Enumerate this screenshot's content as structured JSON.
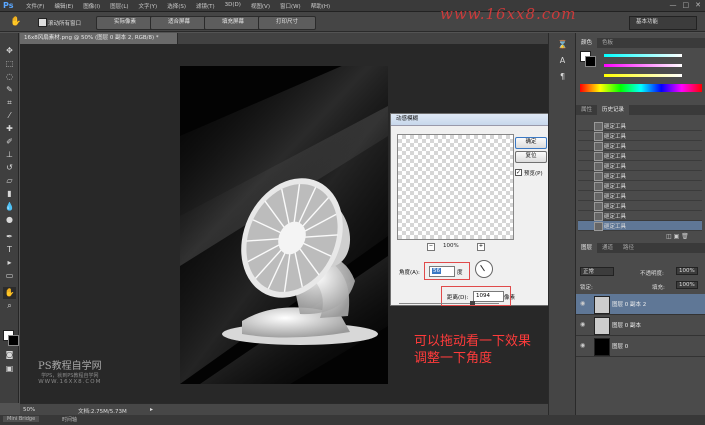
{
  "app": {
    "logo": "Ps"
  },
  "menu": [
    "文件(F)",
    "编辑(E)",
    "图像(I)",
    "图层(L)",
    "文字(Y)",
    "选择(S)",
    "滤镜(T)",
    "3D(D)",
    "视图(V)",
    "窗口(W)",
    "帮助(H)"
  ],
  "window_buttons": [
    "—",
    "□",
    "✕"
  ],
  "options_bar": {
    "checkbox_label": "滚动所有窗口",
    "buttons": [
      "实际像素",
      "适合屏幕",
      "填充屏幕",
      "打印尺寸"
    ],
    "workspace": "基本功能"
  },
  "watermark": "www.16xx8.com",
  "document_tab": "16x8风扇素材.png @ 50% (图层 0 副本 2, RGB/8) *",
  "status": {
    "zoom": "50%",
    "doc_info": "文档:2.75M/5.73M"
  },
  "bottom": {
    "mini_bridge": "Mini Bridge",
    "timeline": "时间轴"
  },
  "panels": {
    "color_tabs": [
      "颜色",
      "色板"
    ],
    "history_tabs": [
      "属性",
      "历史记录"
    ],
    "history_items": [
      "砸定工具",
      "砸定工具",
      "砸定工具",
      "砸定工具",
      "砸定工具",
      "砸定工具",
      "砸定工具",
      "砸定工具",
      "砸定工具",
      "砸定工具",
      "砸定工具",
      "砸定工具"
    ],
    "layers_tabs": [
      "图层",
      "通道",
      "路径"
    ],
    "blend_mode": "正常",
    "opacity_label": "不透明度:",
    "opacity": "100%",
    "lock_label": "锁定:",
    "fill_label": "填充:",
    "fill": "100%",
    "layers": [
      {
        "name": "图层 0 副本 2",
        "selected": true
      },
      {
        "name": "图层 0 副本",
        "selected": false
      },
      {
        "name": "图层 0",
        "selected": false
      }
    ]
  },
  "dialog": {
    "title": "动感模糊",
    "ok": "确定",
    "reset": "复位",
    "preview_label": "预览(P)",
    "zoom": "100%",
    "angle_label": "角度(A):",
    "angle_value": "56",
    "angle_unit": "度",
    "distance_label": "距离(D):",
    "distance_value": "1094",
    "distance_unit": "像素"
  },
  "annotation": {
    "line1": "可以拖动看一下效果",
    "line2": "调整一下角度"
  },
  "site_logo": {
    "line1": "PS教程自学网",
    "line2": "学PS，就到PS教程自学网",
    "line3": "WWW.16XX8.COM"
  },
  "colors": {
    "annotation": "#ff3b3b",
    "ps_blue": "#5aa7ff",
    "selected_layer": "#5f7796"
  }
}
